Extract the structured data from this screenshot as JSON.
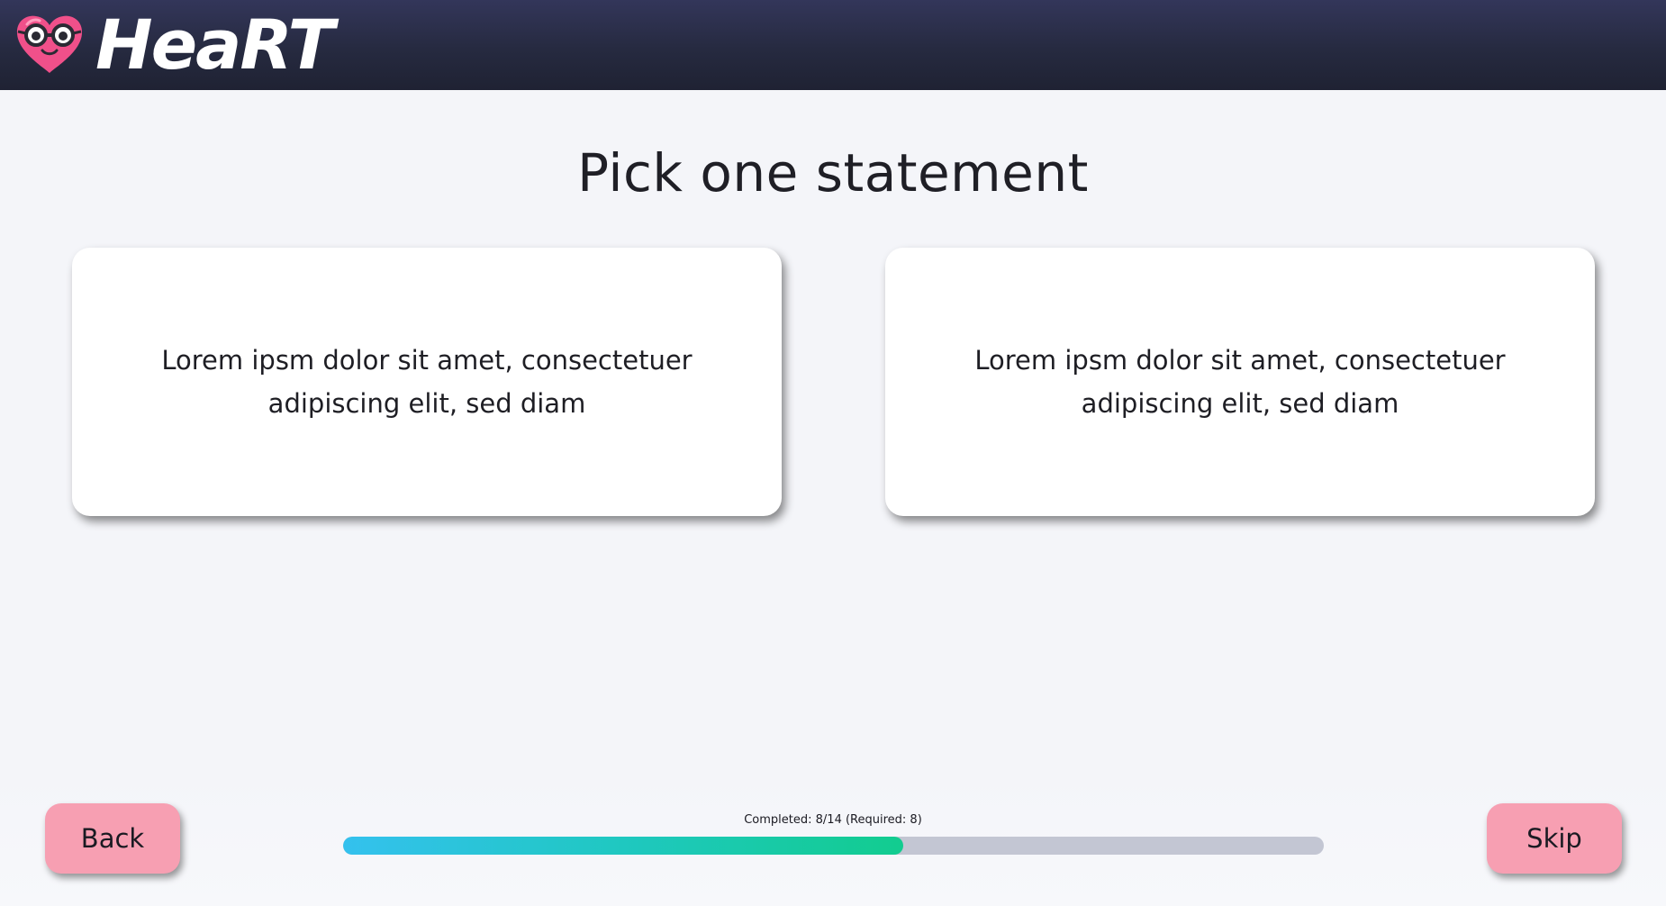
{
  "app": {
    "name": "HeaRT"
  },
  "main": {
    "title": "Pick one statement",
    "options": [
      {
        "text": "Lorem ipsm dolor sit amet, consectetuer adipiscing elit, sed diam"
      },
      {
        "text": "Lorem ipsm dolor sit amet, consectetuer adipiscing elit, sed diam"
      }
    ]
  },
  "footer": {
    "back_label": "Back",
    "skip_label": "Skip",
    "progress_text": "Completed: 8/14 (Required: 8)",
    "progress_completed": 8,
    "progress_total": 14
  },
  "colors": {
    "header_bg": "#262a40",
    "button_bg": "#f79fb2",
    "progress_start": "#34c1ee",
    "progress_end": "#12cc8f",
    "progress_track": "#c3c6d3",
    "logo_heart": "#f0508a"
  },
  "icons": {
    "logo": "heart-with-glasses-icon"
  }
}
